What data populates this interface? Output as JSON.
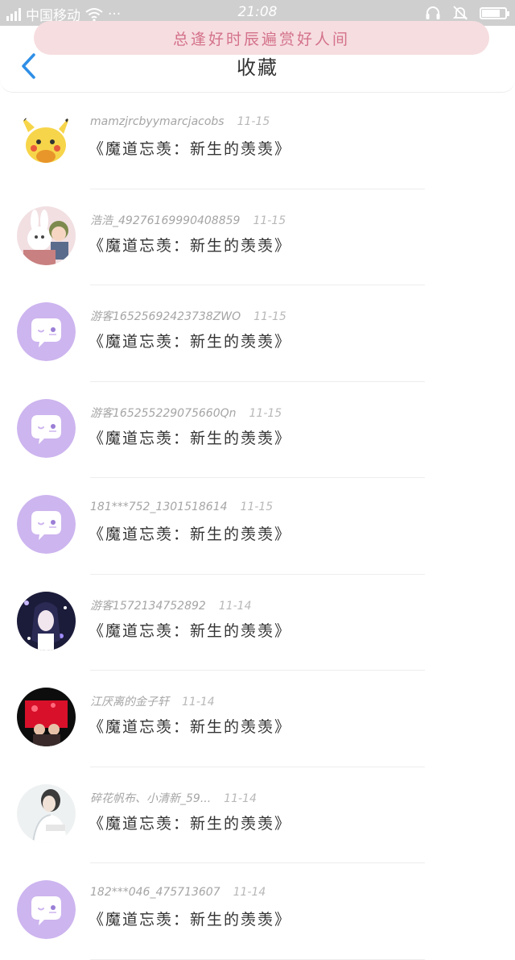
{
  "status_bar": {
    "carrier": "中国移动",
    "dots": "···",
    "time": "21:08",
    "battery_level": 0.8
  },
  "header": {
    "slogan": "总逢好时辰遍赏好人间",
    "title": "收藏"
  },
  "items": [
    {
      "user": "mamzjrcbyymarcjacobs",
      "date": "11-15",
      "work": "《魔道忘羡：新生的羡羡》",
      "avatar": "pikachu"
    },
    {
      "user": "浩浩_49276169990408859",
      "date": "11-15",
      "work": "《魔道忘羡：新生的羡羡》",
      "avatar": "bunny-doll"
    },
    {
      "user": "游客16525692423738ZWO",
      "date": "11-15",
      "work": "《魔道忘羡：新生的羡羡》",
      "avatar": "default"
    },
    {
      "user": "游客165255229075660Qn",
      "date": "11-15",
      "work": "《魔道忘羡：新生的羡羡》",
      "avatar": "default"
    },
    {
      "user": "181***752_1301518614",
      "date": "11-15",
      "work": "《魔道忘羡：新生的羡羡》",
      "avatar": "default"
    },
    {
      "user": "游客1572134752892",
      "date": "11-14",
      "work": "《魔道忘羡：新生的羡羡》",
      "avatar": "anime-dark"
    },
    {
      "user": "江厌离的金子轩",
      "date": "11-14",
      "work": "《魔道忘羡：新生的羡羡》",
      "avatar": "red-photo"
    },
    {
      "user": "碎花帆布、小清新_59...",
      "date": "11-14",
      "work": "《魔道忘羡：新生的羡羡》",
      "avatar": "light-photo"
    },
    {
      "user": "182***046_475713607",
      "date": "11-14",
      "work": "《魔道忘羡：新生的羡羡》",
      "avatar": "default"
    }
  ],
  "colors": {
    "accent_blue": "#2f8fe6",
    "default_avatar": "#cdb5ef",
    "slogan_bg": "#f6dde0",
    "slogan_text": "#d4728a"
  }
}
